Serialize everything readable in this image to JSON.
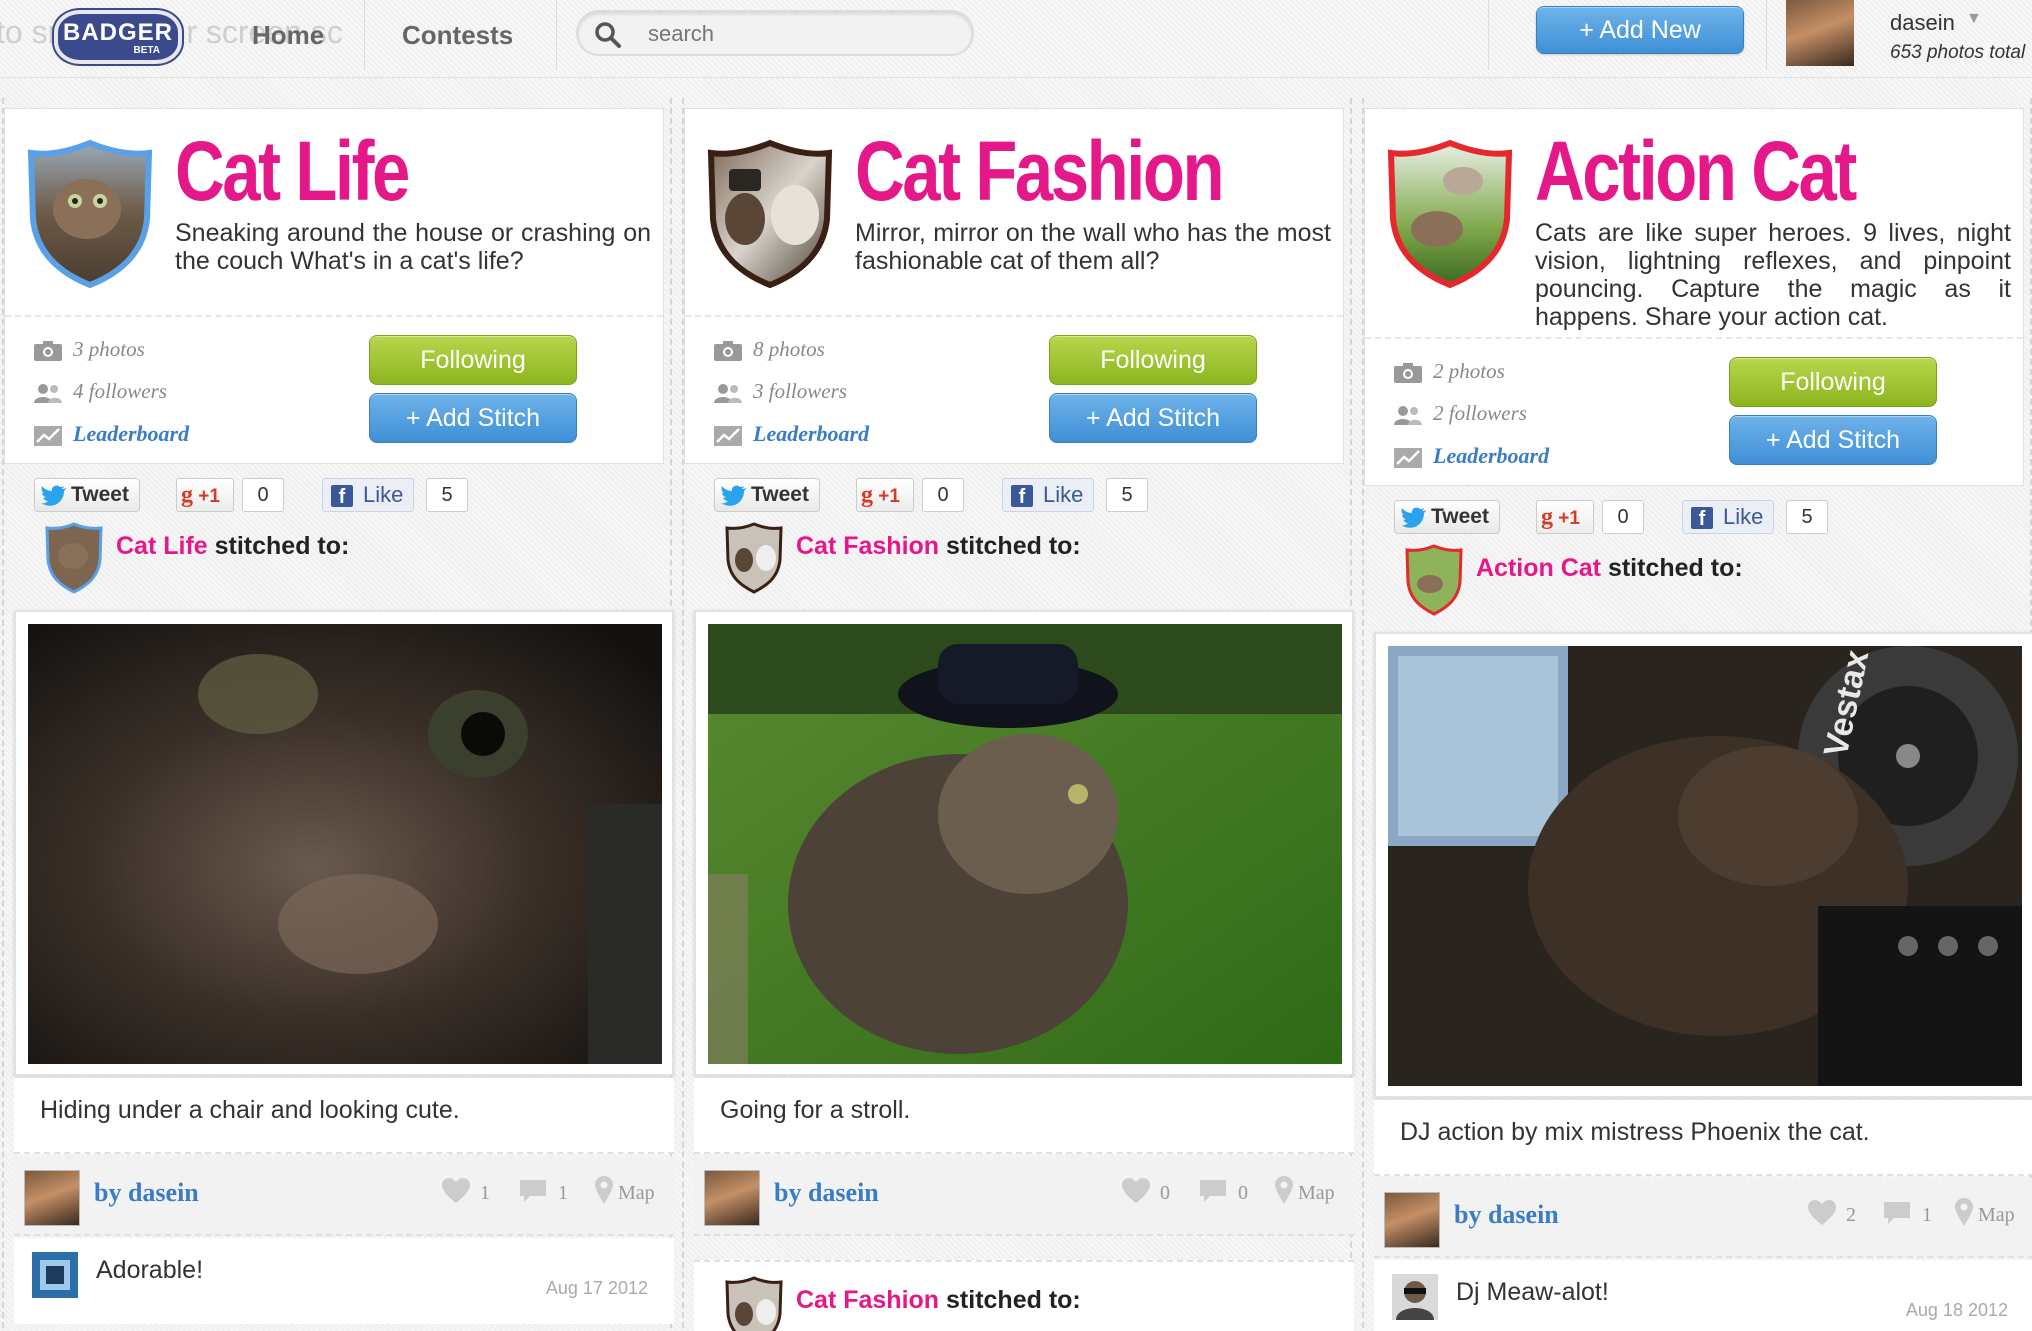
{
  "nav": {
    "ghost_text": "to snap it your screen sc",
    "logo_name": "BADGER",
    "logo_beta": "BETA",
    "home": "Home",
    "contests": "Contests",
    "search_placeholder": "search",
    "add_new": "+ Add New",
    "username": "dasein",
    "photo_count": "653 photos total"
  },
  "colors": {
    "brand_pink": "#e5188a",
    "follow_green": "#9bc431",
    "stitch_blue": "#4a9ae0",
    "link_blue": "#3b7dc4"
  },
  "columns": [
    {
      "title": "Cat Life",
      "description": "Sneaking around the house or crashing on the couch What's in a cat's life?",
      "photos": "3 photos",
      "followers": "4 followers",
      "leaderboard": "Leaderboard",
      "following": "Following",
      "add_stitch": "+ Add Stitch",
      "tweet": "Tweet",
      "gplus": "+1",
      "gplus_count": "0",
      "like": "Like",
      "like_count": "5",
      "stitch_group": "Cat Life",
      "stitch_suffix": " stitched to:",
      "caption": "Hiding under a chair and looking cute.",
      "by": "by dasein",
      "likes": "1",
      "comments": "1",
      "map": "Map",
      "comment_text": "Adorable!",
      "comment_date": "Aug 17 2012"
    },
    {
      "title": "Cat Fashion",
      "description": "Mirror, mirror on the wall who has the most fashionable cat of them all?",
      "photos": "8 photos",
      "followers": "3 followers",
      "leaderboard": "Leaderboard",
      "following": "Following",
      "add_stitch": "+ Add Stitch",
      "tweet": "Tweet",
      "gplus": "+1",
      "gplus_count": "0",
      "like": "Like",
      "like_count": "5",
      "stitch_group": "Cat Fashion",
      "stitch_suffix": " stitched to:",
      "caption": "Going for a stroll.",
      "by": "by dasein",
      "likes": "0",
      "comments": "0",
      "map": "Map",
      "next_stitch_group": "Cat Fashion",
      "next_stitch_suffix": " stitched to:"
    },
    {
      "title": "Action Cat",
      "description": "Cats are like super heroes. 9 lives, night vision, lightning reflexes, and pinpoint pouncing. Capture the magic as it happens. Share your action cat.",
      "photos": "2 photos",
      "followers": "2 followers",
      "leaderboard": "Leaderboard",
      "following": "Following",
      "add_stitch": "+ Add Stitch",
      "tweet": "Tweet",
      "gplus": "+1",
      "gplus_count": "0",
      "like": "Like",
      "like_count": "5",
      "stitch_group": "Action Cat",
      "stitch_suffix": " stitched to:",
      "caption": "DJ action by mix mistress Phoenix the cat.",
      "by": "by dasein",
      "likes": "2",
      "comments": "1",
      "map": "Map",
      "comment_text": "Dj Meaw-alot!",
      "comment_date": "Aug 18 2012",
      "turntable_brand": "Vestax"
    }
  ]
}
